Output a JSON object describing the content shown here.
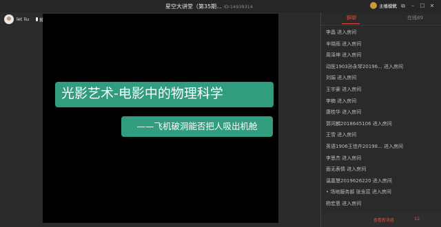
{
  "window": {
    "title": "星空大讲堂（第35期...",
    "room_id": "ID:14939314",
    "host_mode_label": "主播模式",
    "host_mode_icon": "camera-icon",
    "buttons": [
      "settings-icon",
      "popout-icon",
      "minimize-icon",
      "maximize-icon",
      "close-icon"
    ]
  },
  "user": {
    "name": "let liu",
    "mic_label": "排麦"
  },
  "slide": {
    "title": "光影艺术-电影中的物理科学",
    "subtitle": "——飞机破洞能否把人吸出机舱",
    "accent_color": "#2f9d7e"
  },
  "panel": {
    "tabs": [
      {
        "label": "群聊",
        "active": true,
        "color": "#e74c3c"
      },
      {
        "label": "在线89",
        "active": false
      }
    ],
    "messages": [
      {
        "text": "李晶 进入房间"
      },
      {
        "text": "辛晓雨 进入房间"
      },
      {
        "text": "周泽坤 进入房间"
      },
      {
        "text": "动医1903孙永琴20196... 进入房间"
      },
      {
        "text": "刘娟 进入房间"
      },
      {
        "text": "王宇豪 进入房间"
      },
      {
        "text": "李楠 进入房间"
      },
      {
        "text": "康桂华 进入房间"
      },
      {
        "text": "郭河麟2018645106 进入房间"
      },
      {
        "text": "王雪 进入房间"
      },
      {
        "text": "英语1906王佳卉20198... 进入房间"
      },
      {
        "text": "李思杰 进入房间"
      },
      {
        "text": "面无表情 进入房间"
      },
      {
        "text": "温嘉慧2019626220 进入房间"
      },
      {
        "text": "场地服务部 张含蕊 进入房间",
        "bullet": "•"
      },
      {
        "text": "杨宏恩 进入房间"
      }
    ],
    "new_message_label": "查看新消息",
    "message_count": "12"
  }
}
